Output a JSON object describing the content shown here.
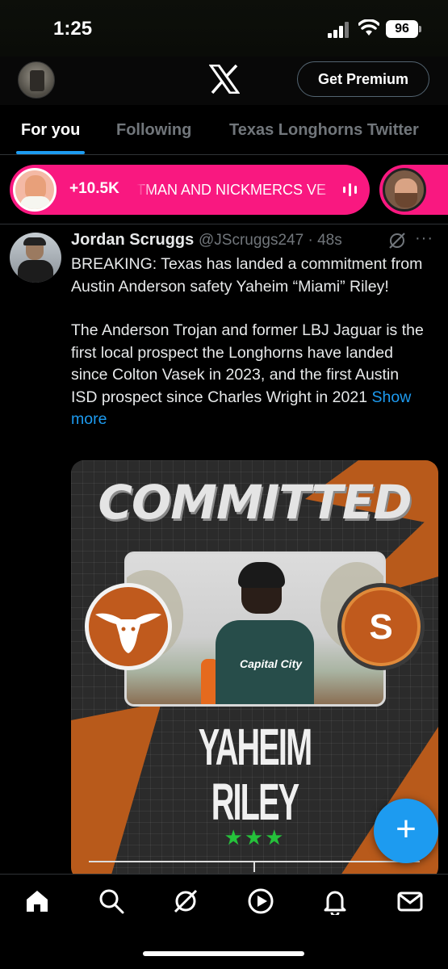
{
  "status_bar": {
    "time": "1:25",
    "battery": "96"
  },
  "header": {
    "premium_label": "Get Premium"
  },
  "tabs": [
    {
      "label": "For you",
      "active": true
    },
    {
      "label": "Following",
      "active": false
    },
    {
      "label": "Texas Longhorns Twitter",
      "active": false
    }
  ],
  "spaces": {
    "count": "+10.5K",
    "title": "TMAN AND NICKMERCS VE"
  },
  "tweet": {
    "name": "Jordan Scruggs",
    "handle_time": "@JScruggs247 · 48s",
    "paragraph1": "BREAKING: Texas has landed a commitment from Austin Anderson safety Yaheim “Miami” Riley!",
    "paragraph2": "The Anderson Trojan and former LBJ Jaguar is the first local prospect the Longhorns have landed since Colton Vasek in 2023, and the first Austin ISD prospect since Charles Wright in 2021",
    "show_more": "Show more",
    "media": {
      "headline": "COMMITTED",
      "jersey_text": "Capital City",
      "badge_letter": "S",
      "first_name": "YAHEIM",
      "last_name": "RILEY",
      "stars": "★★★",
      "star_rating": 3
    }
  },
  "fab": {
    "label": "+"
  },
  "colors": {
    "accent": "#1d9bf0",
    "spaces_pink": "#f91880",
    "burnt_orange": "#c05a1d",
    "star_green": "#25c23b"
  },
  "icons": [
    "signal-icon",
    "wifi-icon",
    "x-logo-icon",
    "grok-icon",
    "more-icon",
    "audio-bars-icon",
    "home-icon",
    "search-icon",
    "grok-nav-icon",
    "video-icon",
    "notifications-icon",
    "messages-icon",
    "longhorn-icon"
  ]
}
